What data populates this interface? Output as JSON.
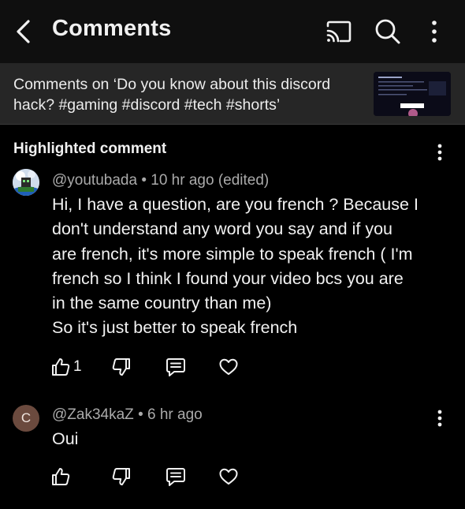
{
  "header": {
    "title": "Comments",
    "icons": [
      "back-arrow-icon",
      "cast-icon",
      "search-icon",
      "more-vertical-icon"
    ]
  },
  "video": {
    "comments_on": "Comments on ‘Do you know about this discord hack? #gaming #discord #tech  #shorts’",
    "thumbnail_caption": "TRICK YOU NEED"
  },
  "highlighted_section": {
    "title": "Highlighted comment"
  },
  "comments": [
    {
      "author": "@youtubada",
      "time": "10 hr ago (edited)",
      "text": "Hi, I have a question, are you french ? Because I\ndon't understand any word you say and if you\nare french, it's more simple to speak french ( I'm\nfrench so I think I found your video bcs you are\nin the same country than me)\nSo it's just better to speak french",
      "likes": "1"
    },
    {
      "author": "@Zak34kaZ",
      "avatar_letter": "C",
      "time": "6 hr ago",
      "text": "Oui",
      "likes": ""
    }
  ],
  "separator": "•",
  "colors": {
    "background": "#000000",
    "header": "#0f0f0f",
    "video_bar": "#262626",
    "text": "#f1f1f1",
    "secondary_text": "#aaaaaa",
    "avatar_c": "#6b4a3e"
  }
}
